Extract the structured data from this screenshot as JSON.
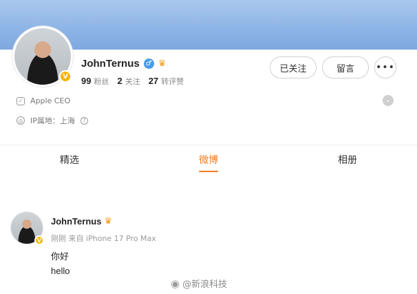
{
  "profile": {
    "username": "JohnTernus",
    "stats": [
      {
        "value": "99",
        "label": "粉丝"
      },
      {
        "value": "2",
        "label": "关注"
      },
      {
        "value": "27",
        "label": "转评赞"
      }
    ],
    "actions": {
      "follow_label": "已关注",
      "message_label": "留言",
      "more_label": "•••"
    },
    "bio": "Apple CEO",
    "ip_location": "IP属地：上海"
  },
  "tabs": [
    {
      "label": "精选",
      "active": false
    },
    {
      "label": "微博",
      "active": true
    },
    {
      "label": "相册",
      "active": false
    }
  ],
  "post": {
    "author": "JohnTernus",
    "meta": "刚刚  来自 iPhone 17 Pro Max",
    "lines": [
      "你好",
      "hello"
    ]
  },
  "watermark": "@新浪科技",
  "colors": {
    "accent": "#f37b1d",
    "verified": "#f5b400",
    "banner": "#8db4e6"
  },
  "icons": {
    "verified": "verified-badge-icon",
    "gender": "male-icon",
    "vip": "crown-icon",
    "bio": "shield-icon",
    "location": "location-icon",
    "help": "help-icon",
    "expand": "chevron-down-icon",
    "weibo": "weibo-logo-icon"
  }
}
